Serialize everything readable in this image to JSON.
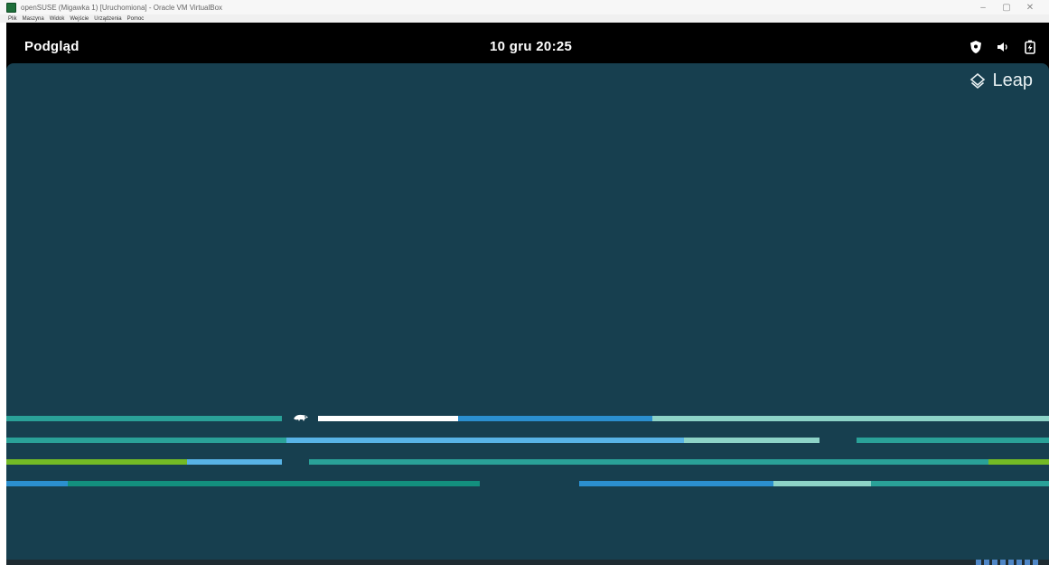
{
  "host_window": {
    "title": "openSUSE (Migawka 1) [Uruchomiona] - Oracle VM VirtualBox",
    "controls": [
      "–",
      "▢",
      "✕"
    ],
    "menu": [
      "Plik",
      "Maszyna",
      "Widok",
      "Wejście",
      "Urządzenia",
      "Pomoc"
    ]
  },
  "guest": {
    "topbar": {
      "activities_label": "Podgląd",
      "clock": "10 gru  20:25",
      "tray_icons": [
        "shield-icon",
        "volume-icon",
        "battery-charging-icon"
      ]
    },
    "desktop": {
      "logo_text": "Leap",
      "background_color": "#173f4f",
      "bar_colors": {
        "teal": "#2aa198",
        "blue": "#2b8fcf",
        "light_blue": "#58b3e6",
        "mint": "#8dd3c7",
        "green": "#73ba25",
        "dark_teal": "#138f7e",
        "white": "#ffffff"
      }
    }
  }
}
